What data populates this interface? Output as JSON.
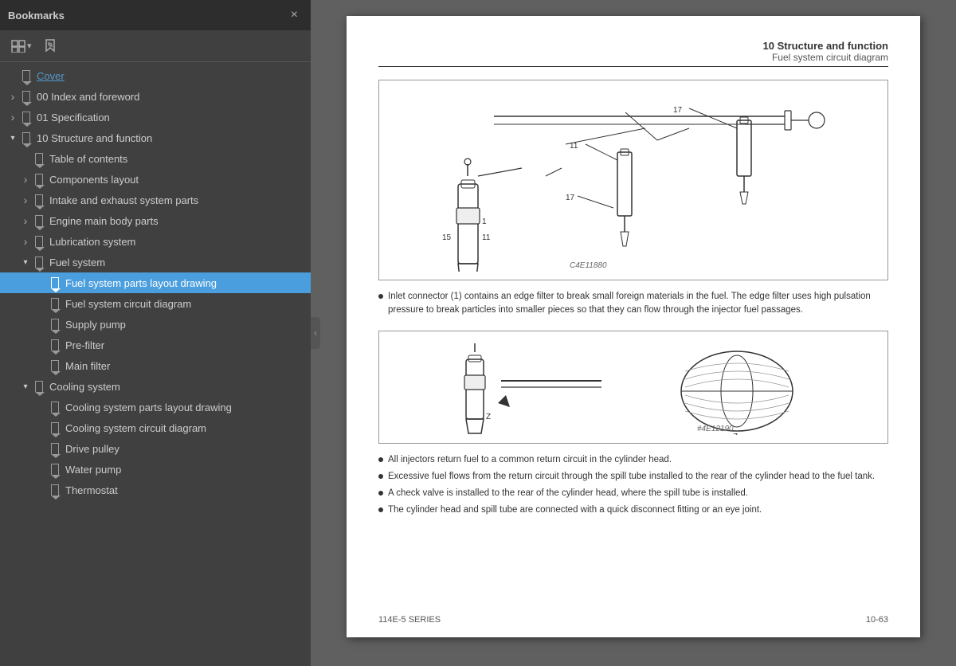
{
  "sidebar": {
    "title": "Bookmarks",
    "close_label": "×",
    "toolbar": {
      "expand_btn": "⊞",
      "bookmark_btn": "🔖"
    },
    "items": [
      {
        "id": "cover",
        "label": "Cover",
        "level": 0,
        "indent": 0,
        "arrow": "empty",
        "expanded": false,
        "active": false,
        "underline": true
      },
      {
        "id": "index",
        "label": "00 Index and foreword",
        "level": 0,
        "indent": 0,
        "arrow": "right",
        "expanded": false,
        "active": false
      },
      {
        "id": "spec",
        "label": "01 Specification",
        "level": 0,
        "indent": 0,
        "arrow": "right",
        "expanded": false,
        "active": false
      },
      {
        "id": "structure",
        "label": "10 Structure and function",
        "level": 0,
        "indent": 0,
        "arrow": "down",
        "expanded": true,
        "active": false
      },
      {
        "id": "toc",
        "label": "Table of contents",
        "level": 1,
        "indent": 1,
        "arrow": "empty",
        "expanded": false,
        "active": false
      },
      {
        "id": "components",
        "label": "Components layout",
        "level": 1,
        "indent": 1,
        "arrow": "right",
        "expanded": false,
        "active": false
      },
      {
        "id": "intake",
        "label": "Intake and exhaust system parts",
        "level": 1,
        "indent": 1,
        "arrow": "right",
        "expanded": false,
        "active": false
      },
      {
        "id": "engine",
        "label": "Engine main body parts",
        "level": 1,
        "indent": 1,
        "arrow": "right",
        "expanded": false,
        "active": false
      },
      {
        "id": "lubrication",
        "label": "Lubrication system",
        "level": 1,
        "indent": 1,
        "arrow": "right",
        "expanded": false,
        "active": false
      },
      {
        "id": "fuel",
        "label": "Fuel system",
        "level": 1,
        "indent": 1,
        "arrow": "down",
        "expanded": true,
        "active": false
      },
      {
        "id": "fuel-parts",
        "label": "Fuel system parts layout drawing",
        "level": 2,
        "indent": 2,
        "arrow": "empty",
        "expanded": false,
        "active": true
      },
      {
        "id": "fuel-circuit",
        "label": "Fuel system circuit diagram",
        "level": 2,
        "indent": 2,
        "arrow": "empty",
        "expanded": false,
        "active": false
      },
      {
        "id": "supply-pump",
        "label": "Supply pump",
        "level": 2,
        "indent": 2,
        "arrow": "empty",
        "expanded": false,
        "active": false
      },
      {
        "id": "pre-filter",
        "label": "Pre-filter",
        "level": 2,
        "indent": 2,
        "arrow": "empty",
        "expanded": false,
        "active": false
      },
      {
        "id": "main-filter",
        "label": "Main filter",
        "level": 2,
        "indent": 2,
        "arrow": "empty",
        "expanded": false,
        "active": false
      },
      {
        "id": "cooling",
        "label": "Cooling system",
        "level": 1,
        "indent": 1,
        "arrow": "down",
        "expanded": true,
        "active": false
      },
      {
        "id": "cooling-parts",
        "label": "Cooling system parts layout drawing",
        "level": 2,
        "indent": 2,
        "arrow": "empty",
        "expanded": false,
        "active": false
      },
      {
        "id": "cooling-circuit",
        "label": "Cooling system circuit diagram",
        "level": 2,
        "indent": 2,
        "arrow": "empty",
        "expanded": false,
        "active": false
      },
      {
        "id": "drive-pulley",
        "label": "Drive pulley",
        "level": 2,
        "indent": 2,
        "arrow": "empty",
        "expanded": false,
        "active": false
      },
      {
        "id": "water-pump",
        "label": "Water pump",
        "level": 2,
        "indent": 2,
        "arrow": "empty",
        "expanded": false,
        "active": false
      },
      {
        "id": "thermostat",
        "label": "Thermostat",
        "level": 2,
        "indent": 2,
        "arrow": "empty",
        "expanded": false,
        "active": false
      }
    ]
  },
  "page": {
    "header_title": "10 Structure and function",
    "header_subtitle": "Fuel system circuit diagram",
    "diagram1_caption": "C4E11880",
    "diagram2_caption": "#4E12190",
    "bullets1": [
      "Inlet connector (1) contains an edge filter to break small foreign materials in the fuel. The edge filter uses high pulsation pressure to break particles into smaller pieces so that they can flow through the injector fuel passages."
    ],
    "bullets2": [
      "All injectors return fuel to a common return circuit in the cylinder head.",
      "Excessive fuel flows from the return circuit through the spill tube installed to the rear of the cylinder head to the fuel tank.",
      "A check valve is installed to the rear of the cylinder head, where the spill tube is installed.",
      "The cylinder head and spill tube are connected with a quick disconnect fitting or an eye joint."
    ],
    "footer_left": "114E-5 SERIES",
    "footer_right": "10-63"
  }
}
